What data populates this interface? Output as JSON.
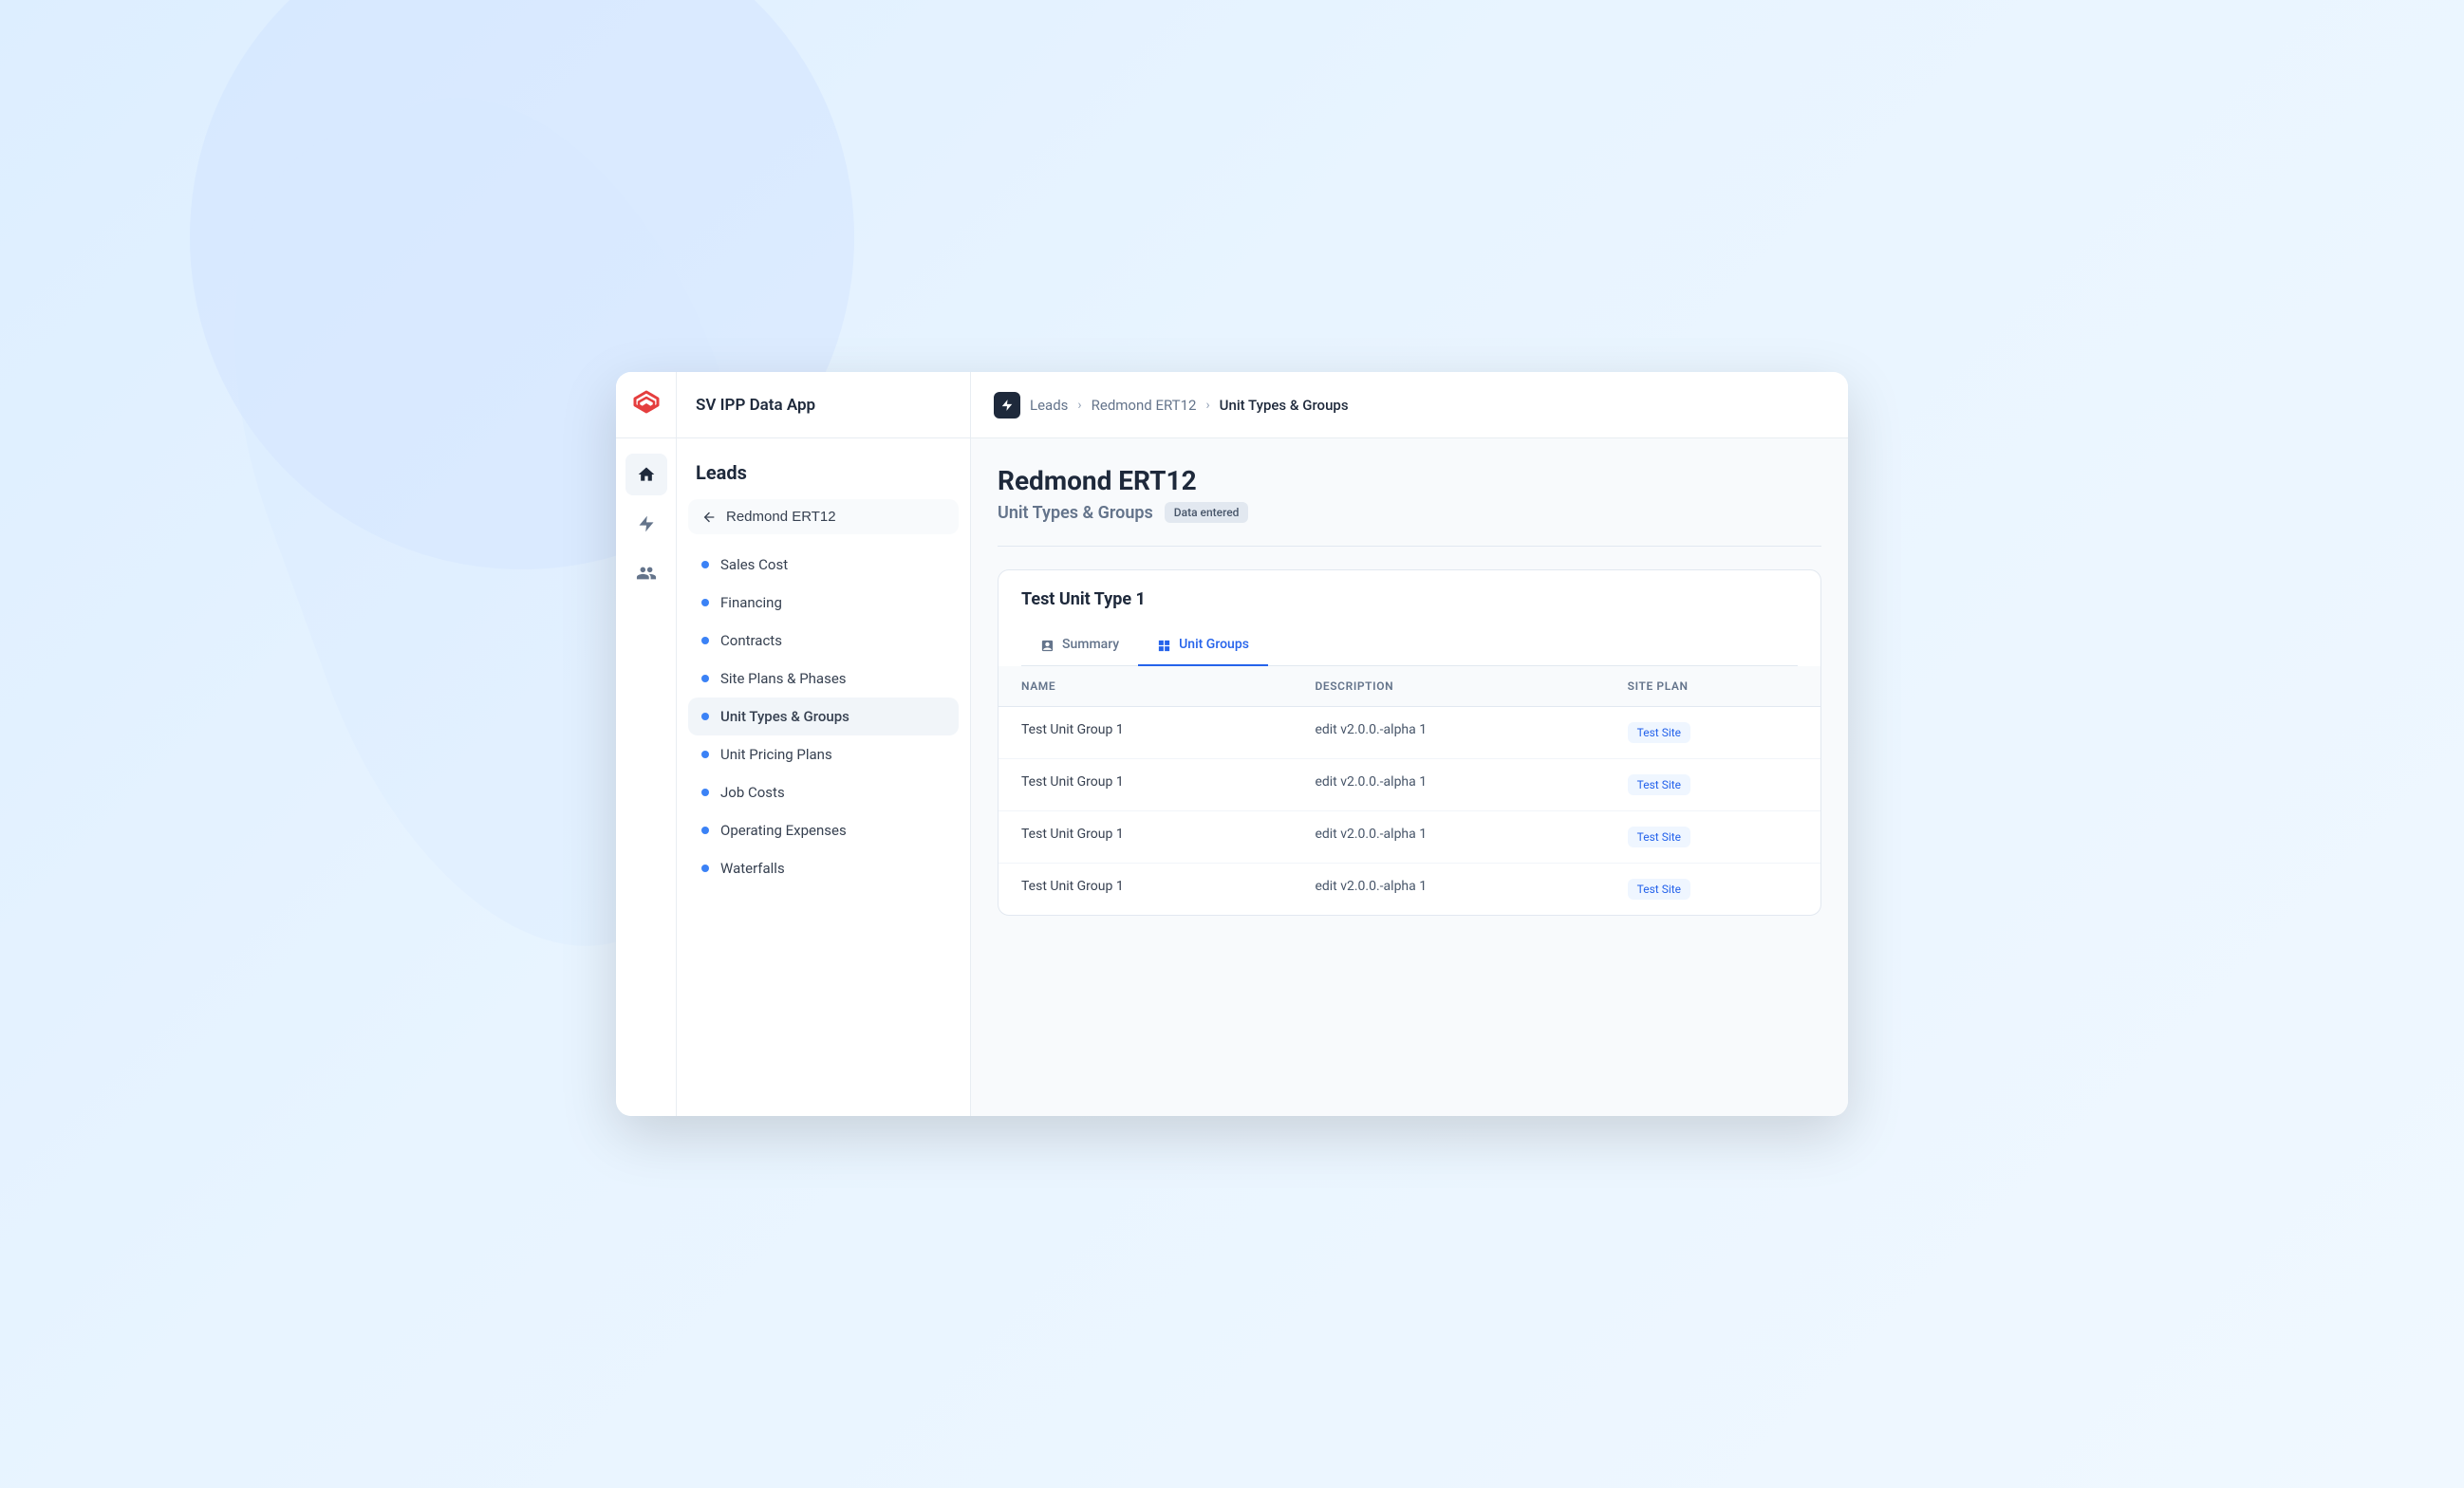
{
  "appTitle": "SV IPP Data App",
  "breadcrumbs": [
    {
      "label": "Leads",
      "active": false
    },
    {
      "label": "Redmond ERT12",
      "active": false
    },
    {
      "label": "Unit Types &amp; Groups",
      "active": true
    }
  ],
  "sidebar": {
    "sectionTitle": "Leads",
    "backButton": "Redmond ERT12",
    "navItems": [
      {
        "label": "Sales Cost",
        "active": false
      },
      {
        "label": "Financing",
        "active": false
      },
      {
        "label": "Contracts",
        "active": false
      },
      {
        "label": "Site Plans & Phases",
        "active": false
      },
      {
        "label": "Unit Types & Groups",
        "active": true
      },
      {
        "label": "Unit Pricing Plans",
        "active": false
      },
      {
        "label": "Job Costs",
        "active": false
      },
      {
        "label": "Operating Expenses",
        "active": false
      },
      {
        "label": "Waterfalls",
        "active": false
      }
    ]
  },
  "pageTitle": "Redmond ERT12",
  "pageSubtitle": "Unit Types & Groups",
  "statusBadge": "Data entered",
  "sectionTitle": "Test Unit Type 1",
  "tabs": [
    {
      "label": "Summary",
      "icon": "📋",
      "active": false
    },
    {
      "label": "Unit Groups",
      "icon": "⊞",
      "active": true
    }
  ],
  "table": {
    "columns": [
      "NAME",
      "DESCRIPTION",
      "SITE PLAN"
    ],
    "rows": [
      {
        "name": "Test Unit Group 1",
        "description": "edit v2.0.0.-alpha 1",
        "sitePlan": "Test Site"
      },
      {
        "name": "Test Unit Group 1",
        "description": "edit v2.0.0.-alpha 1",
        "sitePlan": "Test Site"
      },
      {
        "name": "Test Unit Group 1",
        "description": "edit v2.0.0.-alpha 1",
        "sitePlan": "Test Site"
      },
      {
        "name": "Test Unit Group 1",
        "description": "edit v2.0.0.-alpha 1",
        "sitePlan": "Test Site"
      }
    ]
  }
}
